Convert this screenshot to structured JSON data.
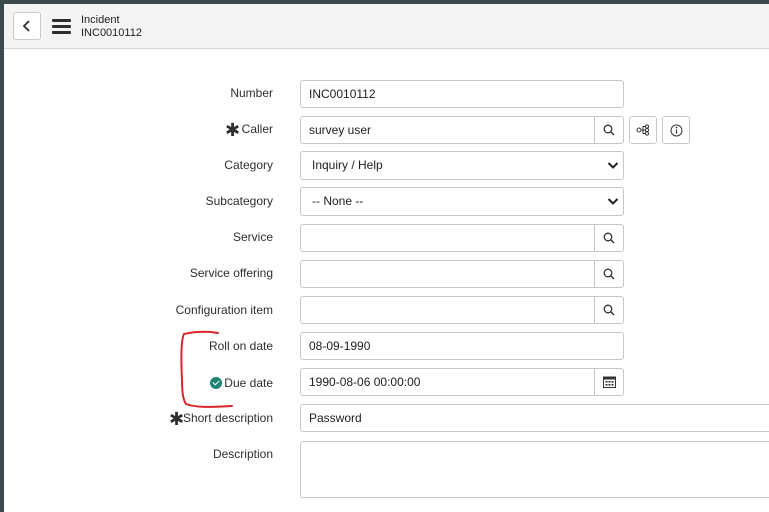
{
  "header": {
    "title": "Incident",
    "number": "INC0010112"
  },
  "form": {
    "number": {
      "label": "Number",
      "value": "INC0010112"
    },
    "caller": {
      "label": "Caller",
      "value": "survey user",
      "required_mark": "✱"
    },
    "category": {
      "label": "Category",
      "value": "Inquiry / Help"
    },
    "subcategory": {
      "label": "Subcategory",
      "value": "-- None --"
    },
    "service": {
      "label": "Service",
      "value": ""
    },
    "service_offering": {
      "label": "Service offering",
      "value": ""
    },
    "configuration_item": {
      "label": "Configuration item",
      "value": ""
    },
    "roll_on_date": {
      "label": "Roll on date",
      "value": "08-09-1990"
    },
    "due_date": {
      "label": "Due date",
      "value": "1990-08-06 00:00:00"
    },
    "short_description": {
      "label": "Short description",
      "value": "Password",
      "required_mark": "✱"
    },
    "description": {
      "label": "Description",
      "value": ""
    }
  },
  "icons": {
    "back": "chevron-left-icon",
    "menu": "hamburger-menu-icon",
    "search": "search-icon",
    "tree": "hierarchy-icon",
    "info": "info-icon",
    "calendar": "calendar-icon",
    "check": "green-check-icon"
  },
  "colors": {
    "annotation": "#d9262b",
    "check": "#1f8476",
    "topbar": "#3c4a4d"
  }
}
